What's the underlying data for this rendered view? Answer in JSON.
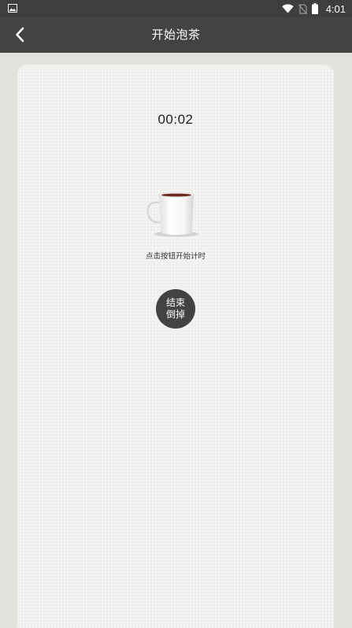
{
  "status_bar": {
    "time": "4:01",
    "icons": [
      "gallery-icon",
      "wifi-icon",
      "no-sim-icon",
      "battery-icon"
    ]
  },
  "toolbar": {
    "title": "开始泡茶",
    "back_icon": "chevron-left-icon"
  },
  "main": {
    "timer": "00:02",
    "hint": "点击按钮开始计时",
    "end_button": {
      "line1": "结束",
      "line2": "倒掉"
    }
  },
  "colors": {
    "bar": "#444243",
    "background": "#e4e2dc",
    "card": "#f3f3f2",
    "button": "#444243"
  }
}
